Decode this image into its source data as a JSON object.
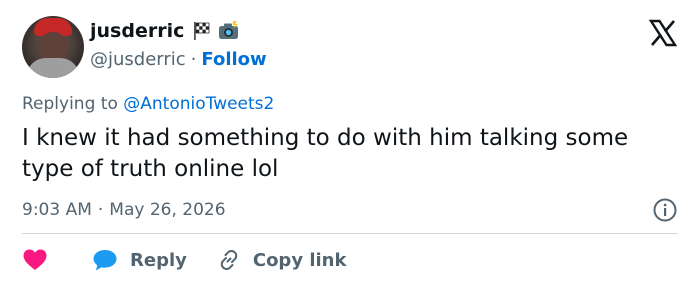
{
  "author": {
    "name": "jusderric",
    "name_emoji_1": "checkered-flag",
    "name_emoji_2": "camera-with-flash",
    "handle": "@jusderric",
    "separator": "·",
    "follow_label": "Follow"
  },
  "logo": "x-logo",
  "reply_context": {
    "prefix": "Replying to ",
    "mention": "@AntonioTweets2"
  },
  "tweet": {
    "text": "I knew it had something to do with him talking some type of truth online lol"
  },
  "meta": {
    "time": "9:03 AM",
    "separator": "·",
    "date": "May 26, 2026"
  },
  "actions": {
    "like_icon": "heart-icon",
    "reply_label": "Reply",
    "copy_label": "Copy link"
  },
  "colors": {
    "accent": "#006fd6",
    "secondary_text": "#536471",
    "like": "#f91880",
    "reply": "#1d9bf0"
  }
}
